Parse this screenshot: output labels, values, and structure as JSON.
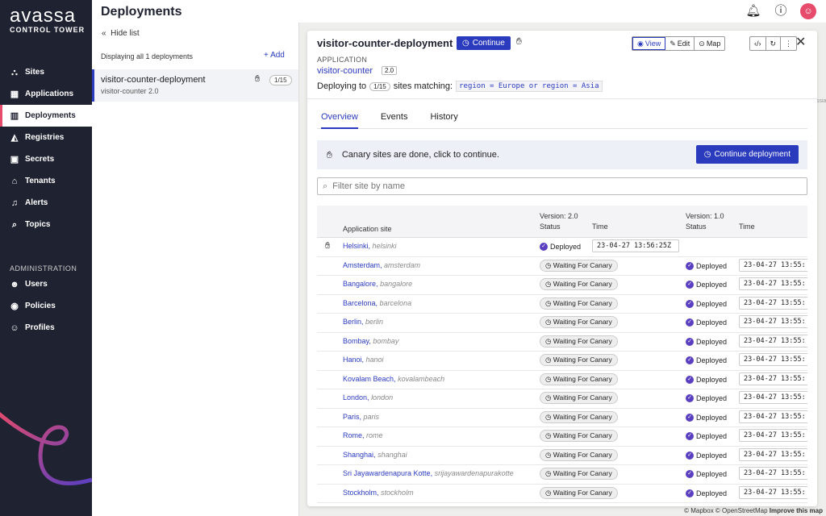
{
  "brand": {
    "logo": "avassa",
    "subtitle": "CONTROL TOWER"
  },
  "header": {
    "title": "Deployments"
  },
  "nav": {
    "items": [
      {
        "label": "Sites",
        "icon": "sites-icon"
      },
      {
        "label": "Applications",
        "icon": "applications-icon"
      },
      {
        "label": "Deployments",
        "icon": "deployments-icon",
        "active": true
      },
      {
        "label": "Registries",
        "icon": "registries-icon"
      },
      {
        "label": "Secrets",
        "icon": "secrets-icon"
      },
      {
        "label": "Tenants",
        "icon": "tenants-icon"
      },
      {
        "label": "Alerts",
        "icon": "bell-icon"
      },
      {
        "label": "Topics",
        "icon": "search-icon"
      }
    ],
    "admin_heading": "ADMINISTRATION",
    "admin_items": [
      {
        "label": "Users",
        "icon": "users-icon"
      },
      {
        "label": "Policies",
        "icon": "policies-icon"
      },
      {
        "label": "Profiles",
        "icon": "profiles-icon"
      }
    ]
  },
  "list": {
    "hide_label": "Hide list",
    "displaying": "Displaying all 1 deployments",
    "add_label": "+ Add",
    "items": [
      {
        "name": "visitor-counter-deployment",
        "sub": "visitor-counter 2.0",
        "badge": "1/15"
      }
    ]
  },
  "detail": {
    "title": "visitor-counter-deployment",
    "continue_label": "Continue",
    "view_label": "View",
    "edit_label": "Edit",
    "map_label": "Map",
    "application_label": "APPLICATION",
    "application_name": "visitor-counter",
    "application_version": "2.0",
    "deploying_to": "Deploying to",
    "deploying_badge": "1/15",
    "sites_matching": "sites matching:",
    "match_expr": "region = Europe or region = Asia",
    "tabs": [
      "Overview",
      "Events",
      "History"
    ],
    "canary_text": "Canary sites are done, click to continue.",
    "continue_deployment": "Continue deployment",
    "filter_placeholder": "Filter site by name"
  },
  "table": {
    "col_site": "Application site",
    "v2_header": "Version: 2.0",
    "v1_header": "Version: 1.0",
    "status": "Status",
    "time": "Time",
    "rows": [
      {
        "site": "Helsinki",
        "slug": "helsinki",
        "v2_status": "Deployed",
        "v2_time": "23-04-27 13:56:25Z",
        "v1_status": "",
        "v1_time": "",
        "canary": true
      },
      {
        "site": "Amsterdam",
        "slug": "amsterdam",
        "v2_status": "Waiting For Canary",
        "v2_time": "",
        "v1_status": "Deployed",
        "v1_time": "23-04-27 13:55:"
      },
      {
        "site": "Bangalore",
        "slug": "bangalore",
        "v2_status": "Waiting For Canary",
        "v2_time": "",
        "v1_status": "Deployed",
        "v1_time": "23-04-27 13:55:"
      },
      {
        "site": "Barcelona",
        "slug": "barcelona",
        "v2_status": "Waiting For Canary",
        "v2_time": "",
        "v1_status": "Deployed",
        "v1_time": "23-04-27 13:55:"
      },
      {
        "site": "Berlin",
        "slug": "berlin",
        "v2_status": "Waiting For Canary",
        "v2_time": "",
        "v1_status": "Deployed",
        "v1_time": "23-04-27 13:55:"
      },
      {
        "site": "Bombay",
        "slug": "bombay",
        "v2_status": "Waiting For Canary",
        "v2_time": "",
        "v1_status": "Deployed",
        "v1_time": "23-04-27 13:55:"
      },
      {
        "site": "Hanoi",
        "slug": "hanoi",
        "v2_status": "Waiting For Canary",
        "v2_time": "",
        "v1_status": "Deployed",
        "v1_time": "23-04-27 13:55:"
      },
      {
        "site": "Kovalam Beach",
        "slug": "kovalambeach",
        "v2_status": "Waiting For Canary",
        "v2_time": "",
        "v1_status": "Deployed",
        "v1_time": "23-04-27 13:55:"
      },
      {
        "site": "London",
        "slug": "london",
        "v2_status": "Waiting For Canary",
        "v2_time": "",
        "v1_status": "Deployed",
        "v1_time": "23-04-27 13:55:"
      },
      {
        "site": "Paris",
        "slug": "paris",
        "v2_status": "Waiting For Canary",
        "v2_time": "",
        "v1_status": "Deployed",
        "v1_time": "23-04-27 13:55:"
      },
      {
        "site": "Rome",
        "slug": "rome",
        "v2_status": "Waiting For Canary",
        "v2_time": "",
        "v1_status": "Deployed",
        "v1_time": "23-04-27 13:55:"
      },
      {
        "site": "Shanghai",
        "slug": "shanghai",
        "v2_status": "Waiting For Canary",
        "v2_time": "",
        "v1_status": "Deployed",
        "v1_time": "23-04-27 13:55:"
      },
      {
        "site": "Sri Jayawardenapura Kotte",
        "slug": "srijayawardenapurakotte",
        "v2_status": "Waiting For Canary",
        "v2_time": "",
        "v1_status": "Deployed",
        "v1_time": "23-04-27 13:55:"
      },
      {
        "site": "Stockholm",
        "slug": "stockholm",
        "v2_status": "Waiting For Canary",
        "v2_time": "",
        "v1_status": "Deployed",
        "v1_time": "23-04-27 13:55:"
      }
    ]
  },
  "map_credits": {
    "mapbox": "© Mapbox",
    "osm": "© OpenStreetMap",
    "improve": "Improve this map"
  },
  "colors": {
    "accent": "#2b3bbd",
    "sidebar": "#1f2231",
    "deployed": "#5a3fc0",
    "avatar": "#e64b6b"
  }
}
